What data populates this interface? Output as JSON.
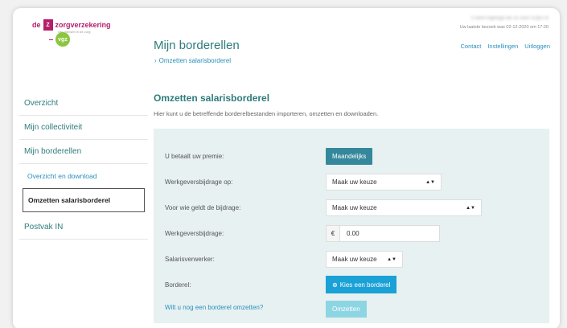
{
  "logo": {
    "box_letter": "Z",
    "prefix": "de",
    "brand": "zorgverzekering",
    "tagline": "van mensen in de zorg",
    "partner": "vgz"
  },
  "topbar": {
    "user_line": "U bent ingelogd als xx xxxx 01@x.nl",
    "last_visit": "Uw laatste bezoek was 02-12-2020 om 17:20",
    "links": [
      "Contact",
      "Instellingen",
      "Uitloggen"
    ]
  },
  "header": {
    "title": "Mijn borderellen",
    "breadcrumb": "Omzetten salarisborderel"
  },
  "sidebar": {
    "items": [
      "Overzicht",
      "Mijn collectiviteit",
      "Mijn borderellen"
    ],
    "sub_items": [
      "Overzicht en download"
    ],
    "active": "Omzetten salarisborderel",
    "last": "Postvak IN"
  },
  "main": {
    "section_title": "Omzetten salarisborderel",
    "description": "Hier kunt u de betreffende borderelbestanden importeren, omzetten en downloaden.",
    "form": {
      "premium_label": "U betaalt uw premie:",
      "premium_value": "Maandelijks",
      "employer_on_label": "Werkgeversbijdrage op:",
      "employer_on_value": "Maak uw keuze",
      "applies_label": "Voor wie geldt de bijdrage:",
      "applies_value": "Maak uw keuze",
      "contribution_label": "Werkgeversbijdrage:",
      "currency": "€",
      "contribution_value": "0.00",
      "processor_label": "Salarisverwerker:",
      "processor_value": "Maak uw keuze",
      "borderel_label": "Borderel:",
      "choose_button": "Kies een borderel",
      "again_link": "Wilt u nog een borderel omzetten?",
      "convert_button": "Omzetten"
    }
  }
}
